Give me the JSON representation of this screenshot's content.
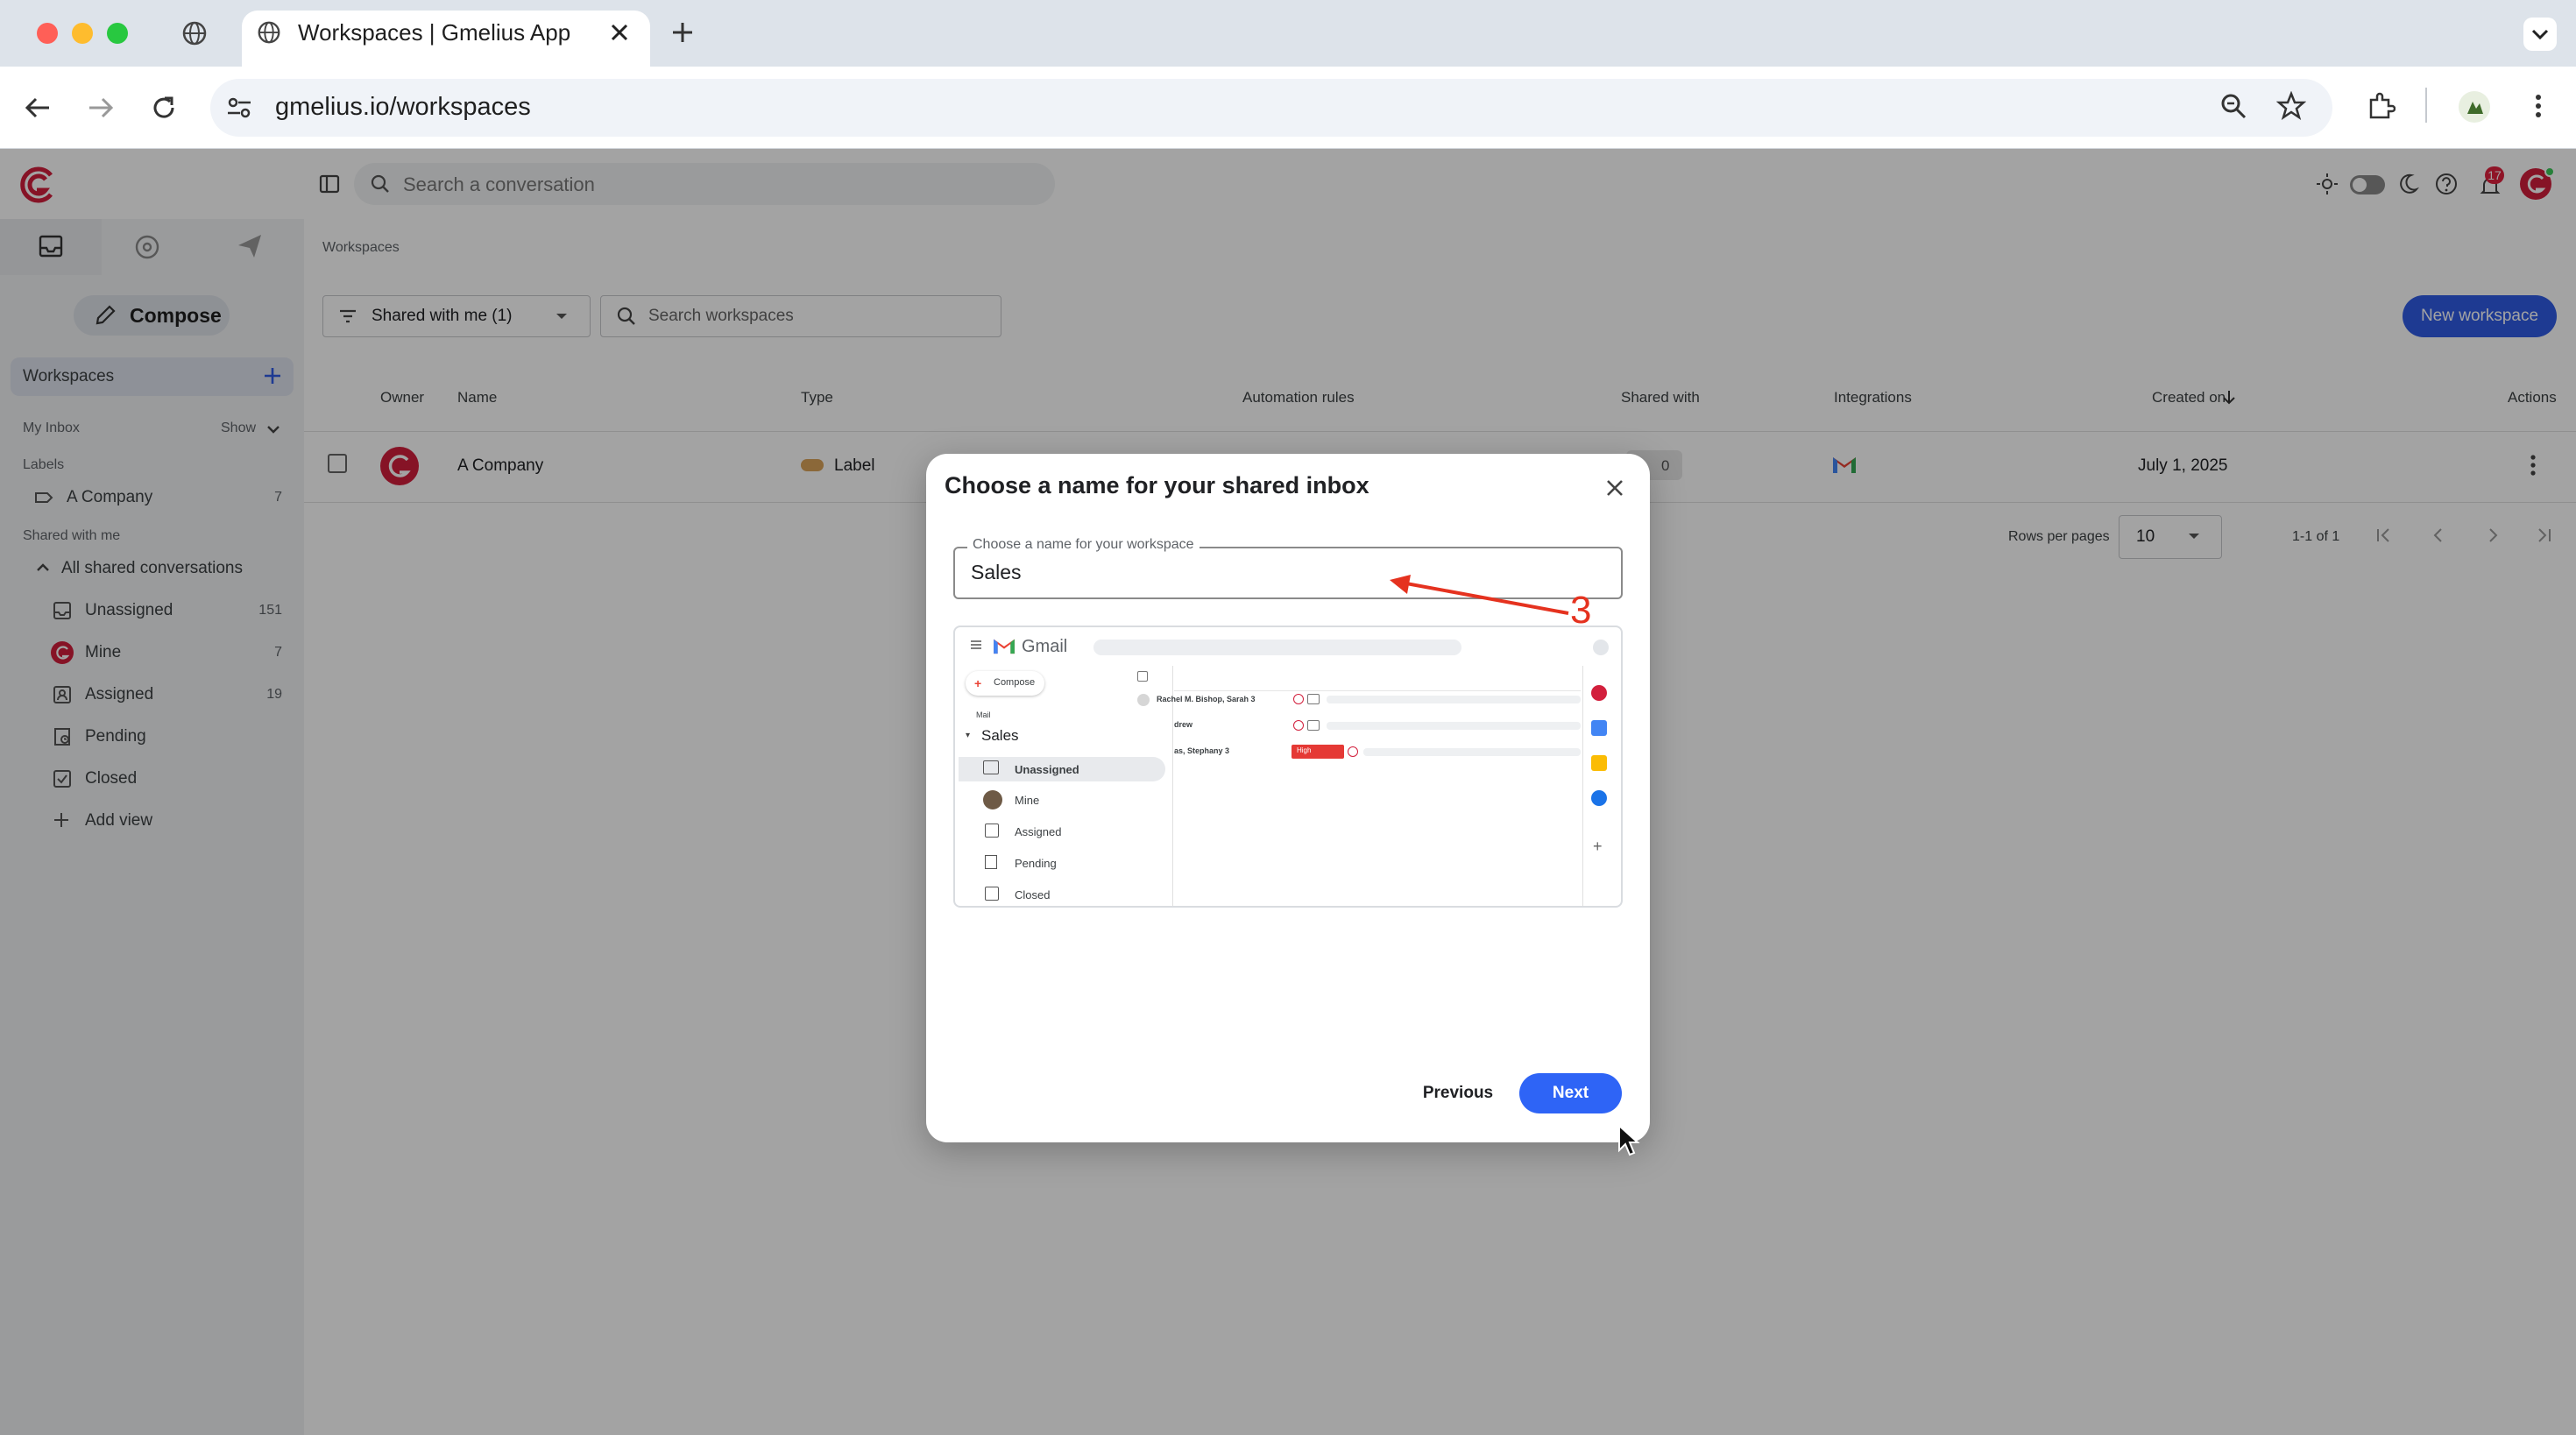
{
  "browser": {
    "tab_title": "Workspaces | Gmelius App",
    "url": "gmelius.io/workspaces"
  },
  "app": {
    "search_placeholder": "Search a conversation",
    "notification_count": "17",
    "compose_label": "Compose",
    "sidebar": {
      "workspaces_label": "Workspaces",
      "my_inbox_label": "My Inbox",
      "show_label": "Show",
      "labels_heading": "Labels",
      "label_item": {
        "label": "A Company",
        "count": "7"
      },
      "shared_heading": "Shared with me",
      "all_shared": "All shared conversations",
      "views": [
        {
          "label": "Unassigned",
          "count": "151",
          "icon": "inbox-icon"
        },
        {
          "label": "Mine",
          "count": "7",
          "icon": "avatar-icon"
        },
        {
          "label": "Assigned",
          "count": "19",
          "icon": "assigned-icon"
        },
        {
          "label": "Pending",
          "count": "",
          "icon": "pending-icon"
        },
        {
          "label": "Closed",
          "count": "",
          "icon": "closed-icon"
        }
      ],
      "add_view": "Add view"
    },
    "breadcrumb": "Workspaces",
    "filter_label": "Shared with me (1)",
    "search_ws_placeholder": "Search workspaces",
    "new_workspace": "New workspace",
    "table": {
      "headers": {
        "owner": "Owner",
        "name": "Name",
        "type": "Type",
        "automation": "Automation rules",
        "shared_with": "Shared with",
        "integrations": "Integrations",
        "created_on": "Created on",
        "actions": "Actions"
      },
      "row": {
        "name": "A Company",
        "type": "Label",
        "shared_with": "0",
        "created_on": "July 1, 2025"
      },
      "rows_per_page_label": "Rows per pages",
      "rows_per_page_value": "10",
      "pagination": "1-1 of 1"
    }
  },
  "modal": {
    "title": "Choose a name for your shared inbox",
    "field_legend": "Choose a name for your workspace",
    "field_value": "Sales",
    "preview": {
      "app_name": "Gmail",
      "compose": "Compose",
      "mail": "Mail",
      "group": "Sales",
      "items": [
        "Unassigned",
        "Mine",
        "Assigned",
        "Pending",
        "Closed"
      ],
      "rows": [
        "Rachel M. Bishop, Sarah 3",
        "drew",
        "as, Stephany 3"
      ],
      "tag": "High"
    },
    "previous": "Previous",
    "next": "Next"
  },
  "annotation": {
    "number": "3",
    "color": "#e5321f"
  },
  "colors": {
    "primary": "#2e64f6",
    "brand_red": "#d21f3c"
  }
}
